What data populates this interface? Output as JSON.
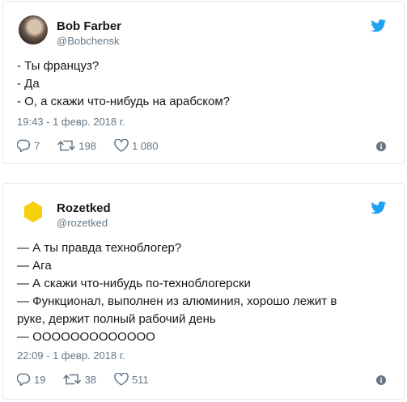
{
  "tweets": [
    {
      "author_name": "Bob Farber",
      "handle": "@Bobchensk",
      "lines": [
        "- Ты француз?",
        "- Да",
        "- О, а скажи что-нибудь на арабском?"
      ],
      "timestamp": "19:43 - 1 февр. 2018 г.",
      "replies": "7",
      "retweets": "198",
      "likes": "1 080"
    },
    {
      "author_name": "Rozetked",
      "handle": "@rozetked",
      "lines": [
        "— А ты правда техноблогер?",
        "— Ага",
        "— А скажи что-нибудь по-техноблогерски",
        "— Функционал, выполнен из алюминия, хорошо лежит в",
        "руке, держит полный рабочий день",
        "— ООООООООООООО"
      ],
      "timestamp": "22:09 - 1 февр. 2018 г.",
      "replies": "19",
      "retweets": "38",
      "likes": "511"
    }
  ],
  "colors": {
    "twitter_blue": "#1da1f2",
    "secondary_text": "#657786",
    "border": "#e1e8ed",
    "rozetked_yellow": "#f5d00f"
  },
  "icons": {
    "bird": "twitter-bird-icon",
    "reply": "reply-icon",
    "retweet": "retweet-icon",
    "like": "heart-icon",
    "info": "info-icon"
  }
}
